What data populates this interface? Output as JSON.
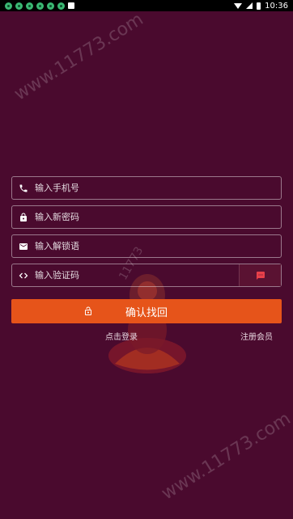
{
  "status": {
    "time": "10:36"
  },
  "watermark": {
    "top": "www.11773.com",
    "middle": "11773",
    "bottom": "www.11773.com"
  },
  "form": {
    "phone_placeholder": "输入手机号",
    "password_placeholder": "输入新密码",
    "unlock_placeholder": "输入解锁语",
    "code_placeholder": "输入验证码",
    "submit_label": "确认找回"
  },
  "links": {
    "login": "点击登录",
    "register": "注册会员"
  },
  "colors": {
    "background": "#4a0a2e",
    "accent": "#e6541a"
  },
  "icons": [
    "phone-icon",
    "lock-icon",
    "mail-icon",
    "code-icon",
    "sms-icon",
    "unlock-icon"
  ]
}
